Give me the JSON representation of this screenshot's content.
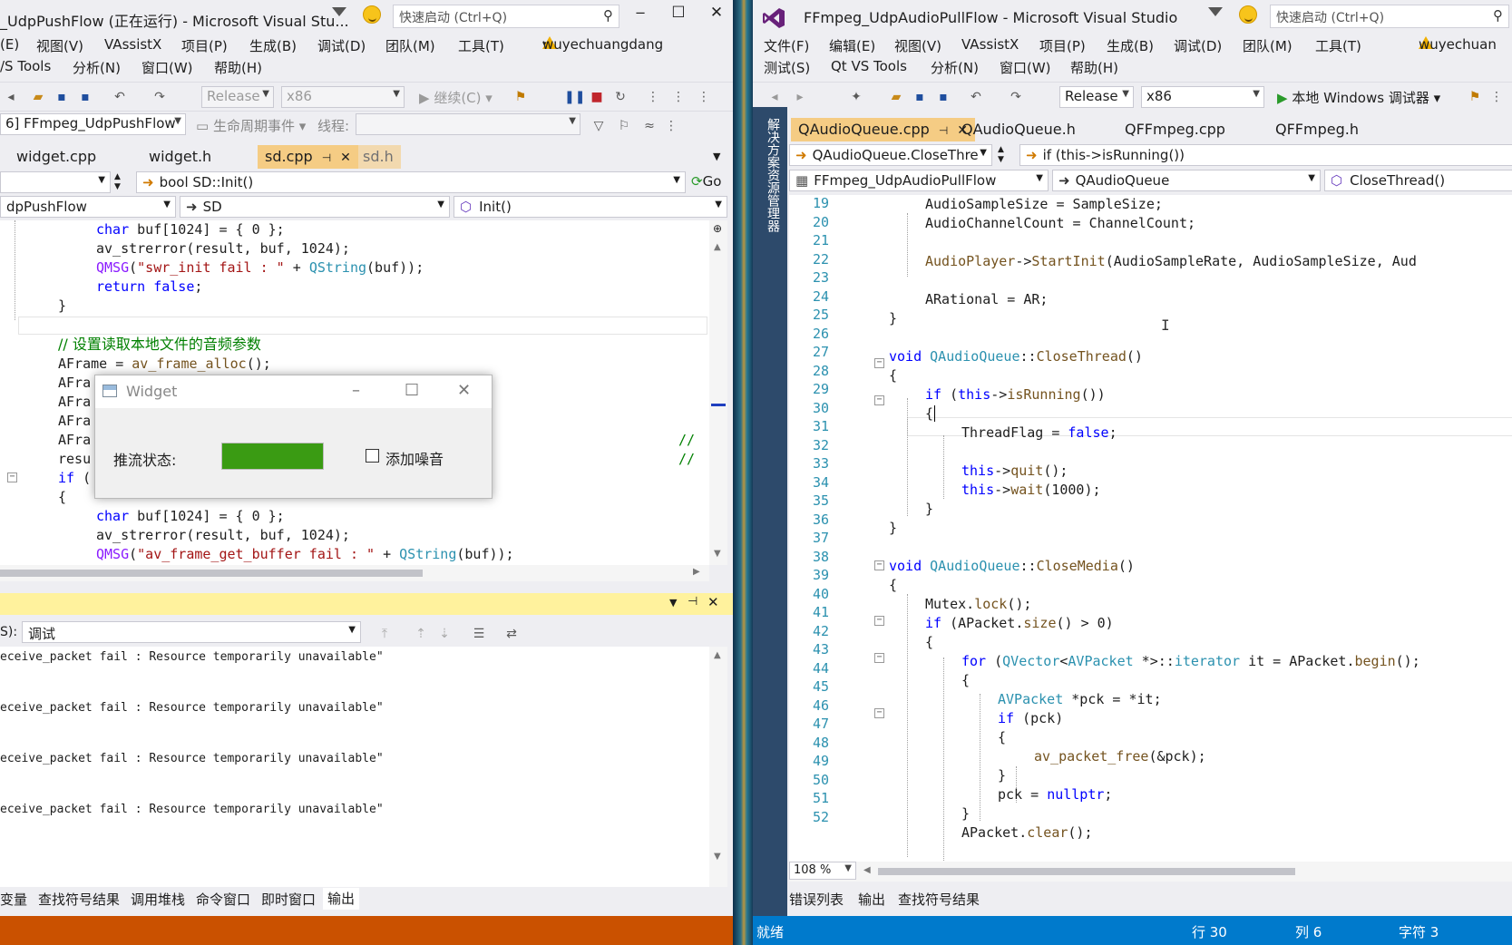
{
  "left": {
    "title": "_UdpPushFlow (正在运行) - Microsoft Visual Stu...",
    "quick_launch": "快速启动 (Ctrl+Q)",
    "menu_row1": [
      "(E)",
      "视图(V)",
      "VAssistX",
      "项目(P)",
      "生成(B)",
      "调试(D)",
      "团队(M)",
      "工具(T)"
    ],
    "user": "wuyechuangdang",
    "menu_row2": [
      "/S Tools",
      "分析(N)",
      "窗口(W)",
      "帮助(H)"
    ],
    "config": "Release",
    "platform": "x86",
    "continue_label": "继续(C)",
    "process": "6] FFmpeg_UdpPushFlow",
    "lifecycle": "生命周期事件",
    "thread_label": "线程:",
    "tabs": [
      "widget.cpp",
      "widget.h",
      "sd.cpp",
      "sd.h"
    ],
    "nav_func": "bool SD::Init()",
    "nav_go": "Go",
    "nav_project": "dpPushFlow",
    "nav_class": "SD",
    "nav_member": "Init()",
    "output_title": "",
    "output_source_label": "S):",
    "output_source": "调试",
    "output_lines": [
      "eceive_packet fail : Resource temporarily unavailable\"",
      "eceive_packet fail : Resource temporarily unavailable\"",
      "eceive_packet fail : Resource temporarily unavailable\"",
      "eceive_packet fail : Resource temporarily unavailable\""
    ],
    "bottom_tabs": [
      "变量",
      "查找符号结果",
      "调用堆栈",
      "命令窗口",
      "即时窗口",
      "输出"
    ]
  },
  "widget": {
    "title": "Widget",
    "status_label": "推流状态:",
    "progress": 1.0,
    "checkbox_label": "添加噪音",
    "checked": false
  },
  "right": {
    "title": "FFmpeg_UdpAudioPullFlow - Microsoft Visual Studio",
    "quick_launch": "快速启动 (Ctrl+Q)",
    "menu_row1": [
      "文件(F)",
      "编辑(E)",
      "视图(V)",
      "VAssistX",
      "项目(P)",
      "生成(B)",
      "调试(D)",
      "团队(M)",
      "工具(T)"
    ],
    "user": "wuyechuan",
    "menu_row2": [
      "测试(S)",
      "Qt VS Tools",
      "分析(N)",
      "窗口(W)",
      "帮助(H)"
    ],
    "config": "Release",
    "platform": "x86",
    "debugger": "本地 Windows 调试器",
    "side_tab": "解决方案资源管理器",
    "tabs": [
      "QAudioQueue.cpp",
      "QAudioQueue.h",
      "QFFmpeg.cpp",
      "QFFmpeg.h"
    ],
    "nav_scope": "QAudioQueue.CloseThre",
    "nav_context": "if (this->isRunning())",
    "nav_project": "FFmpeg_UdpAudioPullFlow",
    "nav_class": "QAudioQueue",
    "nav_member": "CloseThread()",
    "zoom": "108 %",
    "bottom_tabs": [
      "错误列表",
      "输出",
      "查找符号结果"
    ],
    "status": {
      "ready": "就绪",
      "line": "行 30",
      "col": "列 6",
      "char": "字符 3"
    },
    "line_numbers": [
      "19",
      "20",
      "21",
      "22",
      "23",
      "24",
      "25",
      "26",
      "27",
      "28",
      "29",
      "30",
      "31",
      "32",
      "33",
      "34",
      "35",
      "36",
      "37",
      "38",
      "39",
      "40",
      "41",
      "42",
      "43",
      "44",
      "45",
      "46",
      "47",
      "48",
      "49",
      "50",
      "51",
      "52"
    ]
  },
  "colors": {
    "left_status_bg": "#ca5100",
    "right_status_bg": "#007acc",
    "output_title_bg": "#fff29d",
    "progress_fill": "#3a9b13",
    "side_tab_bg": "#2d4a6b"
  }
}
